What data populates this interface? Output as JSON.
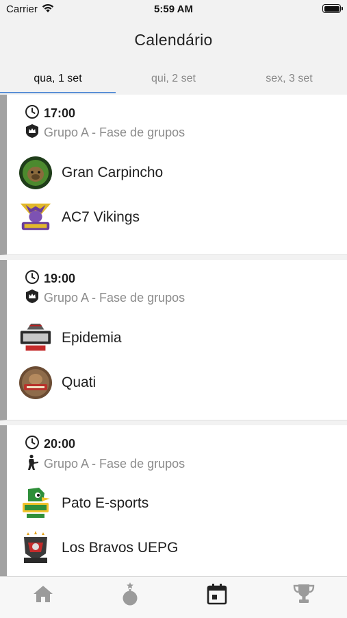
{
  "status_bar": {
    "carrier": "Carrier",
    "time": "5:59 AM"
  },
  "header": {
    "title": "Calendário"
  },
  "tabs": [
    {
      "label": "qua, 1 set",
      "active": true
    },
    {
      "label": "qui, 2 set",
      "active": false
    },
    {
      "label": "sex, 3 set",
      "active": false
    }
  ],
  "matches": [
    {
      "time": "17:00",
      "group": "Grupo A - Fase de grupos",
      "game_icon": "clash-royale-crown-icon",
      "teams": [
        {
          "name": "Gran Carpincho",
          "logo": "gran-carpincho-logo"
        },
        {
          "name": "AC7 Vikings",
          "logo": "ac7-vikings-logo"
        }
      ]
    },
    {
      "time": "19:00",
      "group": "Grupo A - Fase de grupos",
      "game_icon": "clash-royale-crown-icon",
      "teams": [
        {
          "name": "Epidemia",
          "logo": "epidemia-logo"
        },
        {
          "name": "Quati",
          "logo": "quati-logo"
        }
      ]
    },
    {
      "time": "20:00",
      "group": "Grupo A - Fase de grupos",
      "game_icon": "counter-strike-soldier-icon",
      "teams": [
        {
          "name": "Pato E-sports",
          "logo": "pato-esports-logo"
        },
        {
          "name": "Los Bravos UEPG",
          "logo": "los-bravos-uepg-logo"
        }
      ]
    }
  ],
  "tab_bar": [
    {
      "icon": "home-icon",
      "active": false
    },
    {
      "icon": "bomb-icon",
      "active": false
    },
    {
      "icon": "calendar-icon",
      "active": true
    },
    {
      "icon": "trophy-icon",
      "active": false
    }
  ],
  "colors": {
    "accent_underline": "#5a8fd6",
    "card_stripe": "#a2a2a2",
    "muted_text": "#8c8c8c",
    "tab_icon_inactive": "#9b9b9b",
    "tab_icon_active": "#222222"
  }
}
